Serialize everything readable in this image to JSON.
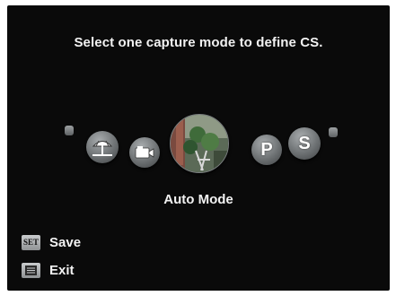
{
  "screen": {
    "title": "Select one capture mode to define CS.",
    "selected_mode_label": "Auto Mode"
  },
  "mode_dial": {
    "items": [
      {
        "name": "scene-mode",
        "icon": "beach-umbrella-icon"
      },
      {
        "name": "movie-mode",
        "icon": "camcorder-icon"
      },
      {
        "name": "auto-mode",
        "icon": "landscape-thumbnail-icon",
        "selected": true
      },
      {
        "name": "program-mode",
        "letter": "P"
      },
      {
        "name": "shutter-priority-mode",
        "letter": "S"
      }
    ]
  },
  "hints": {
    "save": {
      "key": "SET",
      "label": "Save"
    },
    "exit": {
      "key": "menu-icon",
      "label": "Exit"
    }
  },
  "colors": {
    "background": "#0a0a0a",
    "text": "#f2f2f2",
    "mode_button": "#8a8e90"
  }
}
